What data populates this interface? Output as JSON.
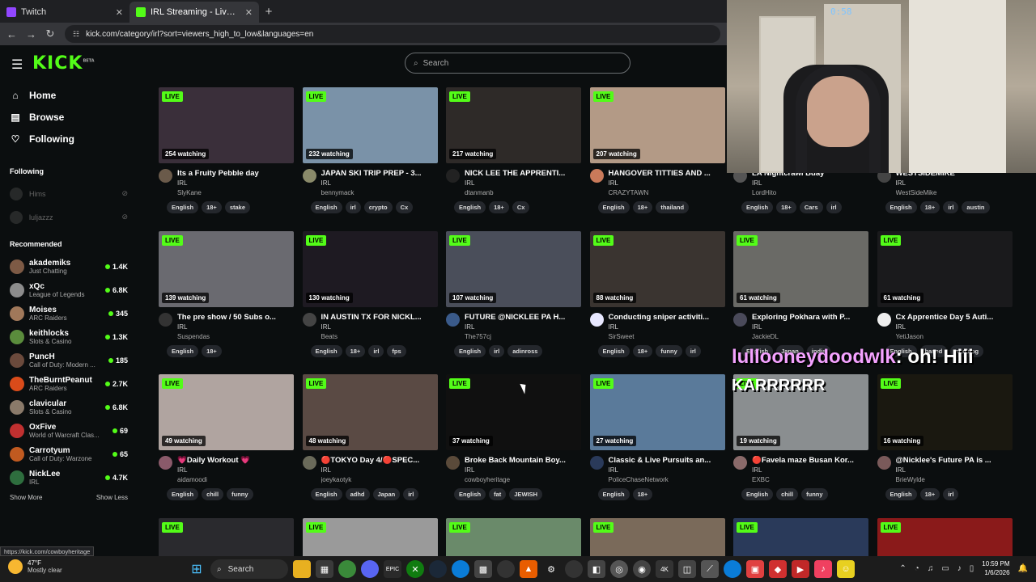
{
  "browser": {
    "tabs": [
      {
        "label": "Twitch",
        "color": "#9146ff",
        "active": false
      },
      {
        "label": "IRL Streaming - Live Streams on Kick",
        "color": "#53fc18",
        "active": true
      }
    ],
    "url": "kick.com/category/irl?sort=viewers_high_to_low&languages=en",
    "status_url": "https://kick.com/cowboyheritage"
  },
  "header": {
    "logo": "KICK",
    "logo_badge": "BETA",
    "search_placeholder": "Search"
  },
  "sidebar": {
    "nav": [
      {
        "label": "Home",
        "icon": "home-icon",
        "glyph": "⌂"
      },
      {
        "label": "Browse",
        "icon": "browse-icon",
        "glyph": "▤"
      },
      {
        "label": "Following",
        "icon": "heart-icon",
        "glyph": "♡"
      }
    ],
    "following_heading": "Following",
    "following": [
      "Hims",
      "luljazzz"
    ],
    "recommended_heading": "Recommended",
    "recommended": [
      {
        "name": "akademiks",
        "category": "Just Chatting",
        "viewers": "1.4K",
        "color": "#7d5a45"
      },
      {
        "name": "xQc",
        "category": "League of Legends",
        "viewers": "6.8K",
        "color": "#8c8c8c"
      },
      {
        "name": "Moises",
        "category": "ARC Raiders",
        "viewers": "345",
        "color": "#a0785a"
      },
      {
        "name": "keithlocks",
        "category": "Slots & Casino",
        "viewers": "1.3K",
        "color": "#5a8c3c"
      },
      {
        "name": "PuncH",
        "category": "Call of Duty: Modern ...",
        "viewers": "185",
        "color": "#6b4a3c"
      },
      {
        "name": "TheBurntPeanut",
        "category": "ARC Raiders",
        "viewers": "2.7K",
        "color": "#d94b1a"
      },
      {
        "name": "clavicular",
        "category": "Slots & Casino",
        "viewers": "6.8K",
        "color": "#8a7a6a"
      },
      {
        "name": "OxFive",
        "category": "World of Warcraft Clas...",
        "viewers": "69",
        "color": "#c03030"
      },
      {
        "name": "Carrotyum",
        "category": "Call of Duty: Warzone",
        "viewers": "65",
        "color": "#c05a20"
      },
      {
        "name": "NickLee",
        "category": "IRL",
        "viewers": "4.7K",
        "color": "#2e6e3e"
      }
    ],
    "show_more": "Show More",
    "show_less": "Show Less"
  },
  "streams": [
    {
      "viewers": "254 watching",
      "title": "Its a Fruity Pebble day",
      "category": "IRL",
      "channel": "SlyKane",
      "tags": [
        "English",
        "18+",
        "stake"
      ],
      "thumb": "#3a2f3a",
      "av": "#6a5a4a"
    },
    {
      "viewers": "232 watching",
      "title": "JAPAN SKI TRIP PREP - 3...",
      "category": "IRL",
      "channel": "bennymack",
      "tags": [
        "English",
        "irl",
        "crypto",
        "Cx"
      ],
      "thumb": "#7a92a8",
      "av": "#8a8a6a"
    },
    {
      "viewers": "217 watching",
      "title": "NICK LEE THE APPRENTI...",
      "category": "IRL",
      "channel": "dtanmanb",
      "tags": [
        "English",
        "18+",
        "Cx"
      ],
      "thumb": "#2e2a28",
      "av": "#222222"
    },
    {
      "viewers": "207 watching",
      "title": "HANGOVER TITTIES AND ...",
      "category": "IRL",
      "channel": "CRAZYTAWN",
      "tags": [
        "English",
        "18+",
        "thailand"
      ],
      "thumb": "#b39a86",
      "av": "#c97a5a"
    },
    {
      "viewers": "",
      "title": "LA Nightcrawl Bday",
      "category": "IRL",
      "channel": "LordHito",
      "tags": [
        "English",
        "18+",
        "Cars",
        "irl"
      ],
      "thumb": "#000000",
      "av": "#555555"
    },
    {
      "viewers": "",
      "title": "WESTSIDEMIKE",
      "category": "IRL",
      "channel": "WestSideMike",
      "tags": [
        "English",
        "18+",
        "irl",
        "austin"
      ],
      "thumb": "#000000",
      "av": "#444444"
    },
    {
      "viewers": "139 watching",
      "title": "The pre show / 50 Subs o...",
      "category": "IRL",
      "channel": "Suspendas",
      "tags": [
        "English",
        "18+"
      ],
      "thumb": "#6a6a70",
      "av": "#333333"
    },
    {
      "viewers": "130 watching",
      "title": "IN AUSTIN TX FOR NICKL...",
      "category": "IRL",
      "channel": "Beats",
      "tags": [
        "English",
        "18+",
        "irl",
        "fps"
      ],
      "thumb": "#1e1a22",
      "av": "#444444"
    },
    {
      "viewers": "107 watching",
      "title": "FUTURE @NICKLEE PA H...",
      "category": "IRL",
      "channel": "The757cj",
      "tags": [
        "English",
        "irl",
        "adinross"
      ],
      "thumb": "#4a4e5a",
      "av": "#3a5a8a"
    },
    {
      "viewers": "88 watching",
      "title": "Conducting sniper activiti...",
      "category": "IRL",
      "channel": "SirSweet",
      "tags": [
        "English",
        "18+",
        "funny",
        "irl"
      ],
      "thumb": "#3a3430",
      "av": "#e8e8ff"
    },
    {
      "viewers": "61 watching",
      "title": "Exploring Pokhara with P...",
      "category": "IRL",
      "channel": "JackieDL",
      "tags": [
        "English",
        "Japan",
        "india"
      ],
      "thumb": "#6a6a66",
      "av": "#4a4a5a"
    },
    {
      "viewers": "61 watching",
      "title": "Cx Apprentice Day 5 Auti...",
      "category": "IRL",
      "channel": "YetiJason",
      "tags": [
        "English",
        "based",
        "cooking"
      ],
      "thumb": "#1a1a1c",
      "av": "#eeeeee"
    },
    {
      "viewers": "49 watching",
      "title": "💗Daily Workout 💗",
      "category": "IRL",
      "channel": "aidamoodi",
      "tags": [
        "English",
        "chill",
        "funny"
      ],
      "thumb": "#b0a4a0",
      "av": "#8a5a6a"
    },
    {
      "viewers": "48 watching",
      "title": "🔴TOKYO Day 4/🔴SPEC...",
      "category": "IRL",
      "channel": "joeykaotyk",
      "tags": [
        "English",
        "adhd",
        "Japan",
        "irl"
      ],
      "thumb": "#5a4a44",
      "av": "#6a6a5a"
    },
    {
      "viewers": "37 watching",
      "title": "Broke Back Mountain Boy...",
      "category": "IRL",
      "channel": "cowboyheritage",
      "tags": [
        "English",
        "fat",
        "JEWISH"
      ],
      "thumb": "#101010",
      "av": "#5a4a3a"
    },
    {
      "viewers": "27 watching",
      "title": "Classic & Live Pursuits an...",
      "category": "IRL",
      "channel": "PoliceChaseNetwork",
      "tags": [
        "English",
        "18+"
      ],
      "thumb": "#5a7a9a",
      "av": "#2a3a5a"
    },
    {
      "viewers": "19 watching",
      "title": "🔴Favela maze Busan Kor...",
      "category": "IRL",
      "channel": "EXBC",
      "tags": [
        "English",
        "chill",
        "funny"
      ],
      "thumb": "#8a8e90",
      "av": "#8a6a6a"
    },
    {
      "viewers": "16 watching",
      "title": "@Nicklee's Future PA is ...",
      "category": "IRL",
      "channel": "BrieWylde",
      "tags": [
        "English",
        "18+",
        "irl"
      ],
      "thumb": "#1a1810",
      "av": "#7a5a5a"
    },
    {
      "viewers": "",
      "title": "",
      "category": "",
      "channel": "",
      "tags": [],
      "thumb": "#2a2a2e",
      "av": "#000000"
    },
    {
      "viewers": "",
      "title": "",
      "category": "",
      "channel": "",
      "tags": [],
      "thumb": "#9a9a9a",
      "av": "#000000"
    },
    {
      "viewers": "",
      "title": "",
      "category": "",
      "channel": "",
      "tags": [],
      "thumb": "#6a8a6a",
      "av": "#000000"
    },
    {
      "viewers": "",
      "title": "",
      "category": "",
      "channel": "",
      "tags": [],
      "thumb": "#7a6a5a",
      "av": "#000000"
    },
    {
      "viewers": "",
      "title": "",
      "category": "",
      "channel": "",
      "tags": [],
      "thumb": "#2a3a5a",
      "av": "#000000"
    },
    {
      "viewers": "",
      "title": "",
      "category": "",
      "channel": "",
      "tags": [],
      "thumb": "#8a1a1a",
      "av": "#000000"
    }
  ],
  "live_label": "LIVE",
  "webcam": {
    "clock": "0:58"
  },
  "chat_overlay": {
    "user": "lullooneydoodwlk",
    "message": ": oh! Hiii",
    "karr": "KARRRRRR"
  },
  "taskbar": {
    "temp": "47°F",
    "condition": "Mostly clear",
    "search_label": "Search",
    "time": "10:59 PM",
    "date": "1/6/2026"
  }
}
